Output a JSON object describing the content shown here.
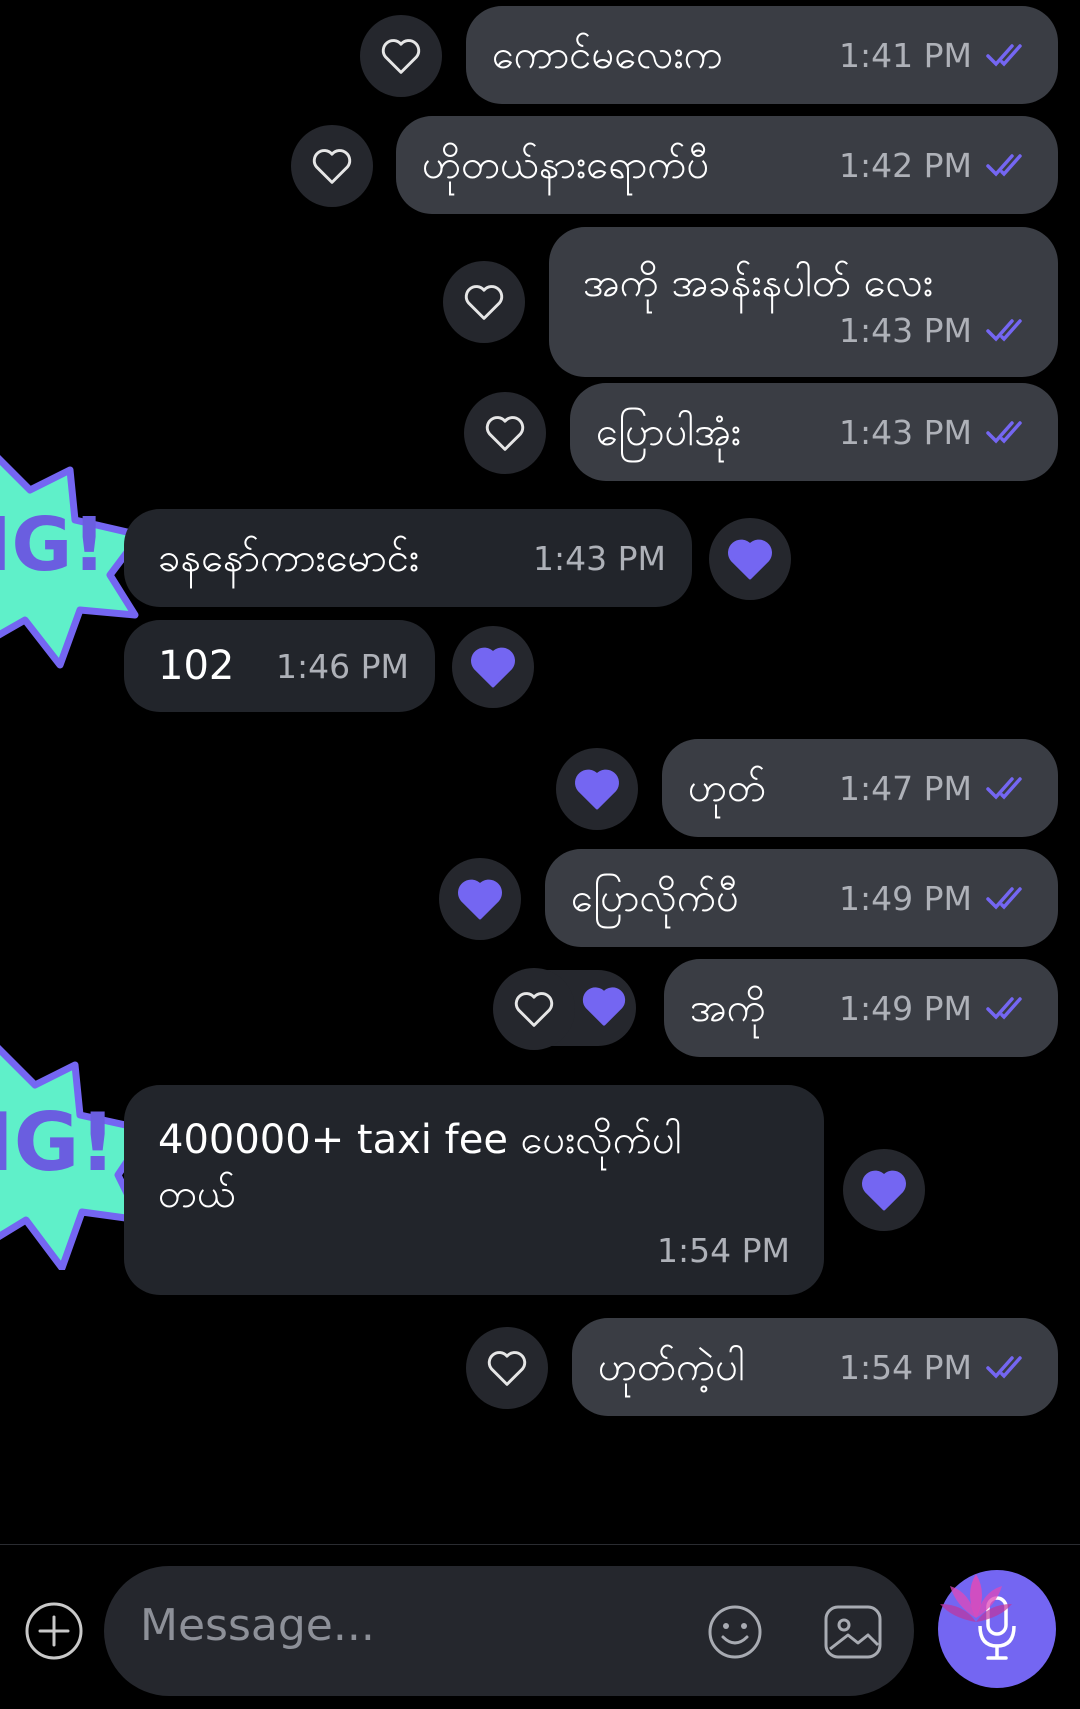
{
  "colors": {
    "accent": "#7466f2",
    "bubble_out": "#3a3d44",
    "bubble_in": "#22252b",
    "sticker": "#5ff0c9"
  },
  "messages": [
    {
      "text": "ကောင်မလေးက",
      "time": "1:41 PM",
      "direction": "out",
      "liked": false
    },
    {
      "text": "ဟိုတယ်နားရောက်ပီ",
      "time": "1:42 PM",
      "direction": "out",
      "liked": false
    },
    {
      "text": "အကို အခန်းနပါတ် လေး",
      "time": "1:43 PM",
      "direction": "out",
      "liked": false
    },
    {
      "text": "ပြောပါအုံး",
      "time": "1:43 PM",
      "direction": "out",
      "liked": false
    },
    {
      "text": "ခနနော်ကားမောင်း",
      "time": "1:43 PM",
      "direction": "in",
      "liked": true
    },
    {
      "text": "102",
      "time": "1:46 PM",
      "direction": "in",
      "liked": true
    },
    {
      "text": "ဟုတ်",
      "time": "1:47 PM",
      "direction": "out",
      "liked": true
    },
    {
      "text": "ပြောလိုက်ပီ",
      "time": "1:49 PM",
      "direction": "out",
      "liked": true
    },
    {
      "text": "အကို",
      "time": "1:49 PM",
      "direction": "out",
      "liked": true
    },
    {
      "text_line1": "400000+ taxi fee ပေးလိုက်ပါ",
      "text_line2": "တယ်",
      "time": "1:54 PM",
      "direction": "in",
      "liked": true
    },
    {
      "text": "ဟုတ်ကဲ့ပါ",
      "time": "1:54 PM",
      "direction": "out",
      "liked": false
    }
  ],
  "sticker": {
    "text": "IG!"
  },
  "composer": {
    "placeholder": "Message..."
  }
}
